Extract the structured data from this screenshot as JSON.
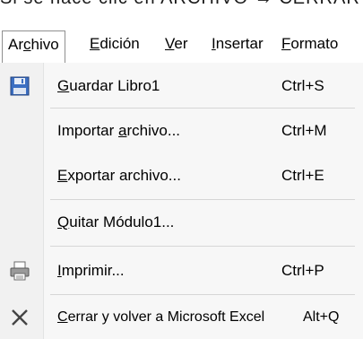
{
  "caption": "Si se hace clic en ARCHIVO → CERRAR",
  "menubar": {
    "items": [
      {
        "pre": "Ar",
        "acc": "c",
        "post": "hivo"
      },
      {
        "pre": "",
        "acc": "E",
        "post": "dición"
      },
      {
        "pre": "",
        "acc": "V",
        "post": "er"
      },
      {
        "pre": "",
        "acc": "I",
        "post": "nsertar"
      },
      {
        "pre": "",
        "acc": "F",
        "post": "ormato"
      }
    ]
  },
  "menu": {
    "items": [
      {
        "icon": "save-disk-icon",
        "pre": "",
        "acc": "G",
        "post": "uardar Libro1",
        "shortcut": "Ctrl+S"
      },
      {
        "icon": "",
        "pre": "Importar ",
        "acc": "a",
        "post": "rchivo...",
        "shortcut": "Ctrl+M"
      },
      {
        "icon": "",
        "pre": "",
        "acc": "E",
        "post": "xportar archivo...",
        "shortcut": "Ctrl+E"
      },
      {
        "icon": "",
        "pre": "",
        "acc": "Q",
        "post": "uitar Módulo1...",
        "shortcut": ""
      },
      {
        "icon": "printer-icon",
        "pre": "",
        "acc": "I",
        "post": "mprimir...",
        "shortcut": "Ctrl+P"
      },
      {
        "icon": "close-x-icon",
        "pre": "",
        "acc": "C",
        "post": "errar y volver a Microsoft Excel",
        "shortcut": "Alt+Q"
      }
    ]
  }
}
